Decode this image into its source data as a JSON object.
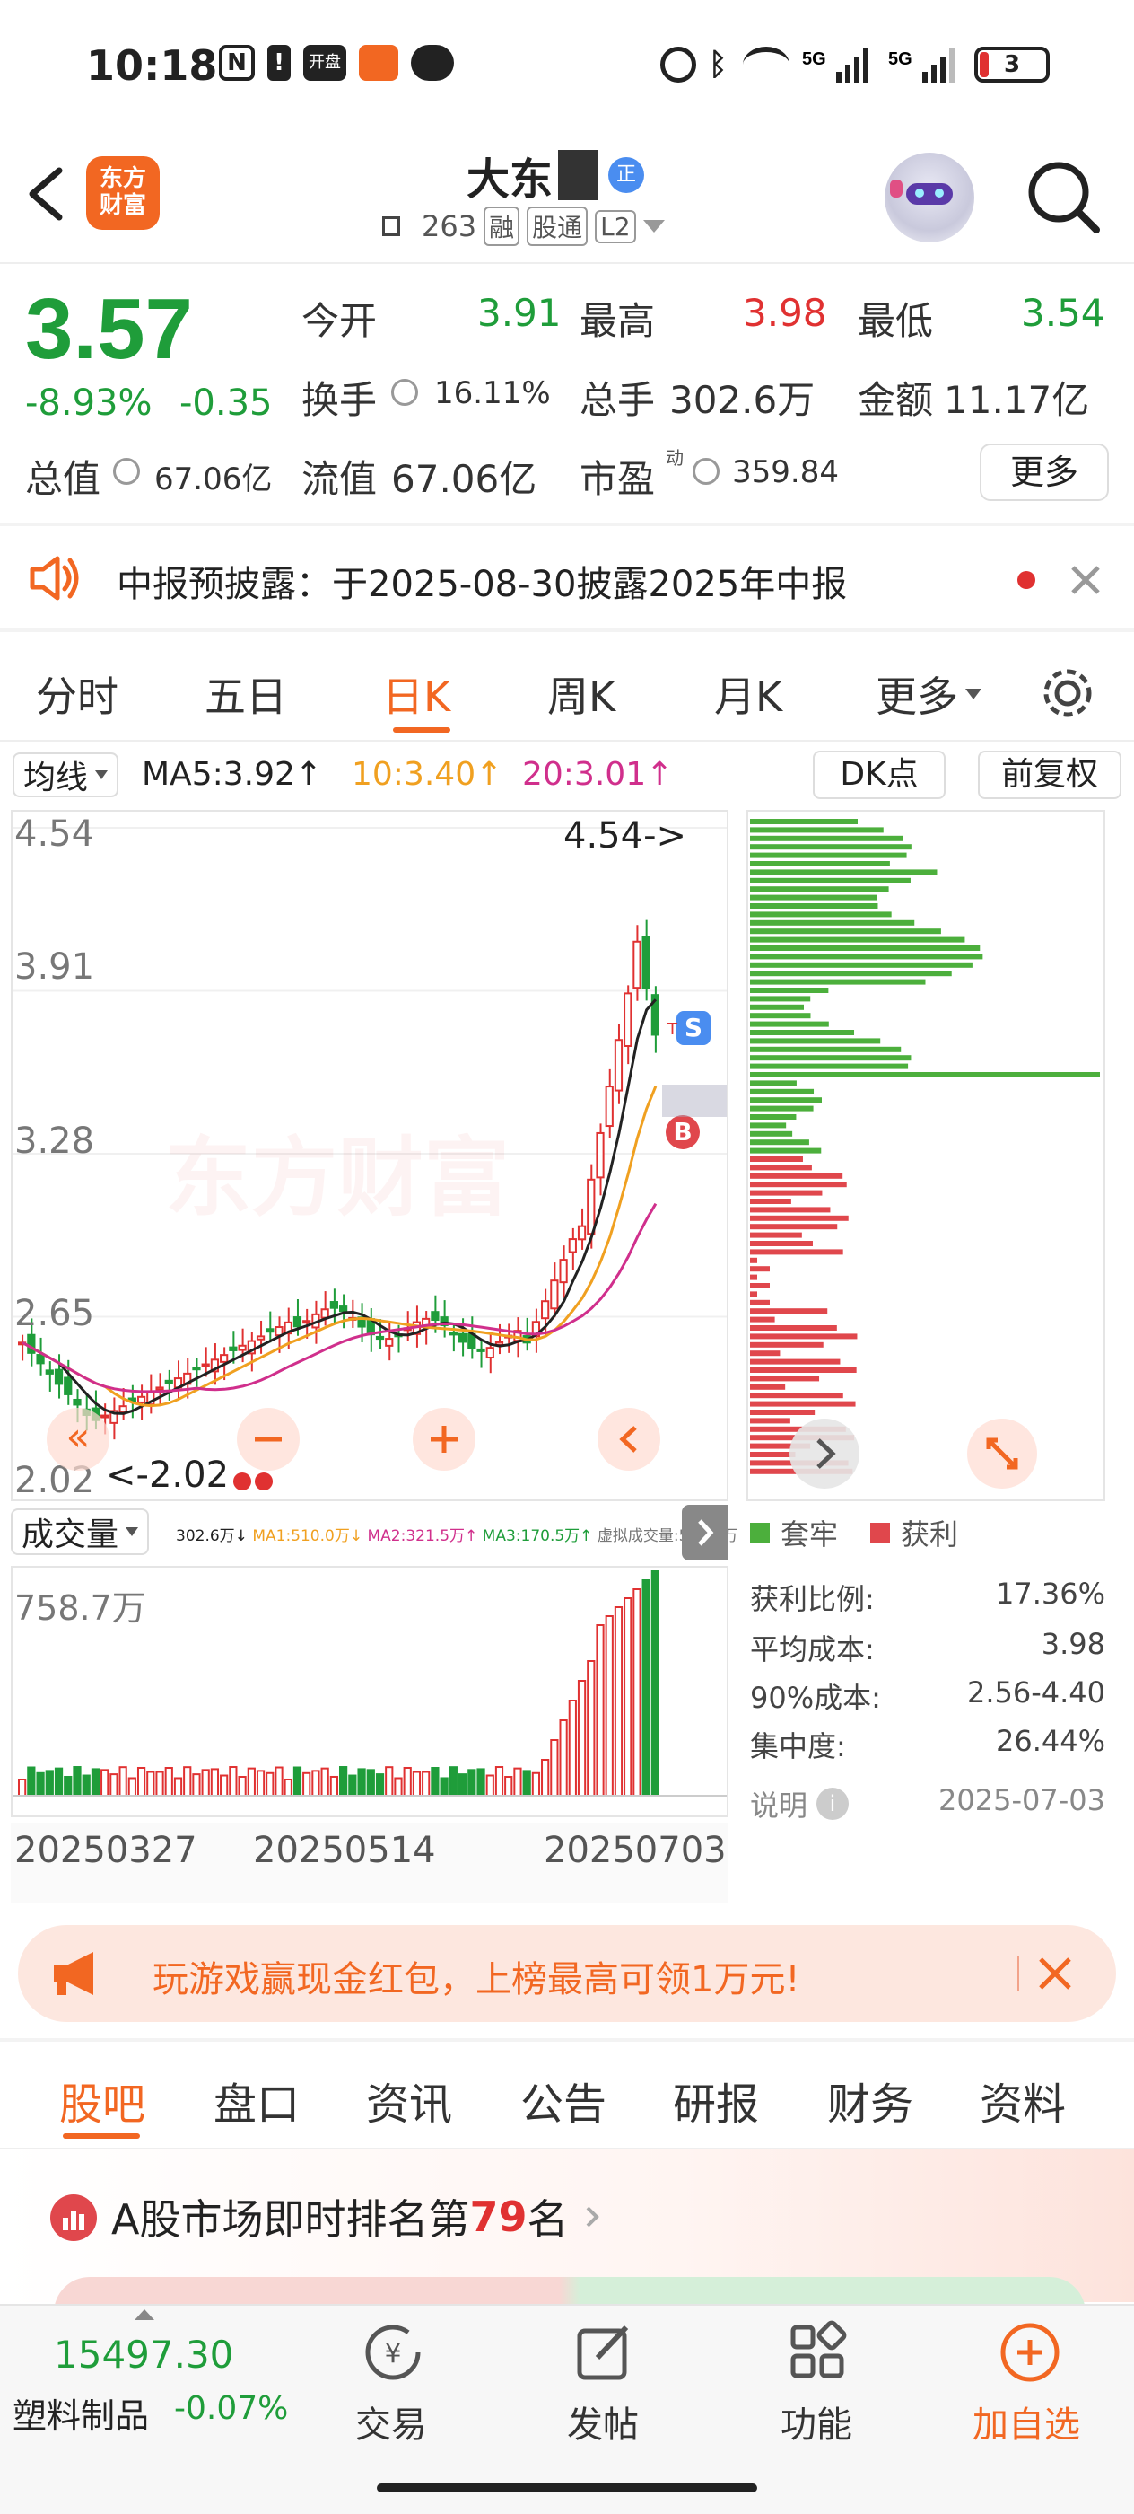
{
  "status_bar": {
    "time": "10:18",
    "battery": "3"
  },
  "header": {
    "logo_text": "东方财富",
    "stock_name": "大东",
    "badge": "正",
    "sub_code": "263",
    "tag_rong": "融",
    "tag_tong": "股通",
    "tag_l2": "L2"
  },
  "quote": {
    "price": "3.57",
    "change_pct": "-8.93%",
    "change_amt": "-0.35",
    "open_label": "今开",
    "open_value": "3.91",
    "high_label": "最高",
    "high_value": "3.98",
    "low_label": "最低",
    "low_value": "3.54",
    "turnover_label": "换手",
    "turnover_value": "16.11%",
    "volume_label": "总手",
    "volume_value": "302.6万",
    "amount_label": "金额",
    "amount_value": "11.17亿",
    "mktcap_label": "总值",
    "mktcap_value": "67.06亿",
    "float_label": "流值",
    "float_value": "67.06亿",
    "pe_label": "市盈",
    "pe_sup": "动",
    "pe_value": "359.84",
    "more_button": "更多"
  },
  "notice": {
    "text": "中报预披露：于2025-08-30披露2025年中报"
  },
  "chart_tabs": [
    {
      "label": "分时",
      "active": false
    },
    {
      "label": "五日",
      "active": false
    },
    {
      "label": "日K",
      "active": true
    },
    {
      "label": "周K",
      "active": false
    },
    {
      "label": "月K",
      "active": false
    },
    {
      "label": "更多",
      "active": false
    }
  ],
  "ma_bar": {
    "selector": "均线",
    "ma5": "MA5:3.92↑",
    "ma10": "10:3.40↑",
    "ma20": "20:3.01↑",
    "dk_button": "DK点",
    "adjust_button": "前复权"
  },
  "kline": {
    "y_ticks": [
      "4.54",
      "3.91",
      "3.28",
      "2.65",
      "2.02"
    ],
    "high_marker": "4.54->",
    "low_marker": "<-2.02",
    "watermark": "东方财富",
    "marker_s": "S",
    "marker_b": "B",
    "marker_t": "T"
  },
  "volume": {
    "selector": "成交量",
    "stats": "302.6万↓",
    "ma1": "MA1:510.0万↓",
    "ma2": "MA2:321.5万↑",
    "ma3": "MA3:170.5万↑",
    "virtual": "虚拟成交量:541.9万",
    "max_label": "758.7万",
    "dates": [
      "20250327",
      "20250514",
      "20250703"
    ]
  },
  "chips": {
    "legend_trapped": "套牢",
    "legend_profit": "获利",
    "rows": [
      {
        "label": "获利比例:",
        "value": "17.36%"
      },
      {
        "label": "平均成本:",
        "value": "3.98"
      },
      {
        "label": "90%成本:",
        "value": "2.56-4.40"
      },
      {
        "label": "集中度:",
        "value": "26.44%"
      }
    ],
    "note_label": "说明",
    "date": "2025-07-03",
    "colors": {
      "trapped": "#4caf3c",
      "profit": "#e0474c"
    }
  },
  "promo": {
    "text": "玩游戏赢现金红包，上榜最高可领1万元!"
  },
  "bottom_tabs": [
    {
      "label": "股吧",
      "active": true
    },
    {
      "label": "盘口",
      "active": false
    },
    {
      "label": "资讯",
      "active": false
    },
    {
      "label": "公告",
      "active": false
    },
    {
      "label": "研报",
      "active": false
    },
    {
      "label": "财务",
      "active": false
    },
    {
      "label": "资料",
      "active": false
    }
  ],
  "rank": {
    "prefix": "A股市场即时排名第",
    "number": "79",
    "suffix": "名"
  },
  "nav": {
    "index_value": "15497.30",
    "index_name": "塑料制品",
    "index_change": "-0.07%",
    "items": [
      {
        "label": "交易",
        "icon": "yuan-cycle-icon"
      },
      {
        "label": "发帖",
        "icon": "edit-icon"
      },
      {
        "label": "功能",
        "icon": "grid-icon"
      },
      {
        "label": "加自选",
        "icon": "add-circle-icon"
      }
    ]
  },
  "colors": {
    "up": "#e03131",
    "down": "#1f9d3a",
    "accent": "#f26722"
  }
}
